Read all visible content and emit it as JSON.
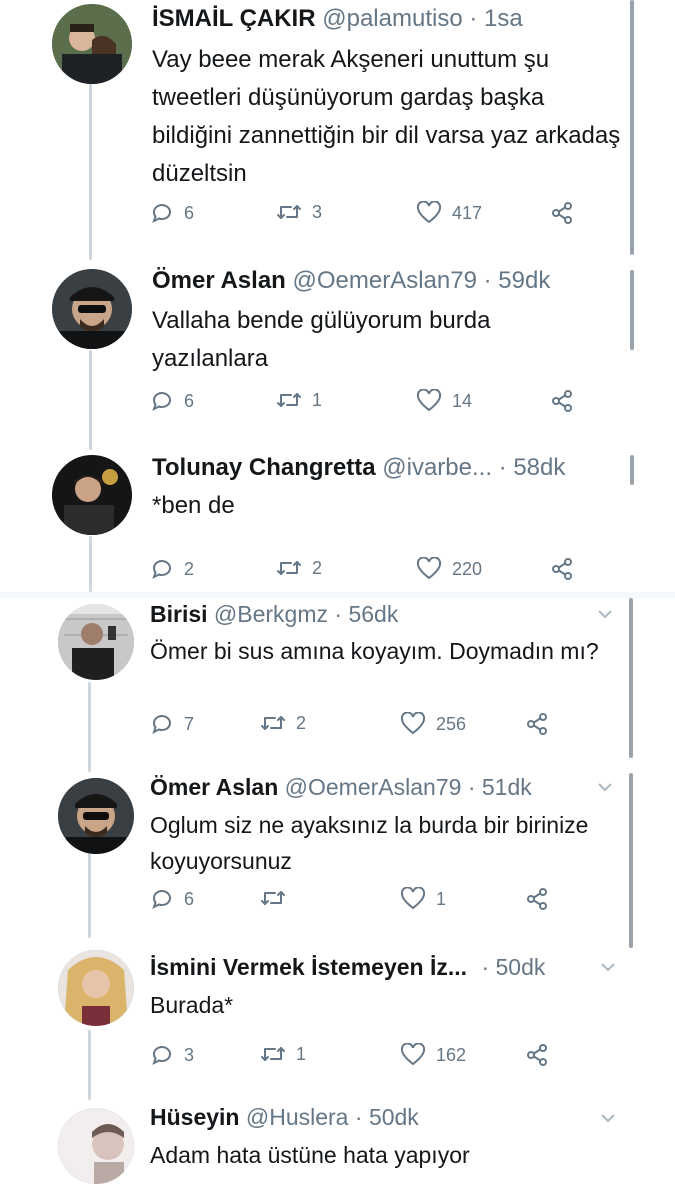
{
  "tweets": [
    {
      "name": "İSMAİL ÇAKIR",
      "handle": "@palamutiso",
      "time": "1sa",
      "text": "Vay beee merak Akşeneri unuttum şu tweetleri düşünüyorum gardaş başka bildiğini zannettiğin bir dil varsa yaz arkadaş düzeltsin",
      "replies": "6",
      "retweets": "3",
      "likes": "417"
    },
    {
      "name": "Ömer Aslan",
      "handle": "@OemerAslan79",
      "time": "59dk",
      "text": "Vallaha bende gülüyorum burda yazılanlara",
      "replies": "6",
      "retweets": "1",
      "likes": "14"
    },
    {
      "name": "Tolunay Changretta",
      "handle": "@ivarbe...",
      "time": "58dk",
      "text": "*ben de",
      "replies": "2",
      "retweets": "2",
      "likes": "220"
    },
    {
      "name": "Birisi",
      "handle": "@Berkgmz",
      "time": "56dk",
      "text": "Ömer bi sus amına koyayım. Doymadın mı?",
      "replies": "7",
      "retweets": "2",
      "likes": "256"
    },
    {
      "name": "Ömer Aslan",
      "handle": "@OemerAslan79",
      "time": "51dk",
      "text": "Oglum siz ne ayaksınız la burda bir birinize koyuyorsunuz",
      "replies": "6",
      "retweets": "",
      "likes": "1"
    },
    {
      "name": "İsmini Vermek İstemeyen İz...",
      "handle": "",
      "time": "50dk",
      "text": "Burada*",
      "replies": "3",
      "retweets": "1",
      "likes": "162"
    },
    {
      "name": "Hüseyin",
      "handle": "@Huslera",
      "time": "50dk",
      "text": "Adam hata üstüne hata yapıyor",
      "replies": "",
      "retweets": "",
      "likes": ""
    }
  ],
  "separator": "·",
  "colors": {
    "name": "#14171a",
    "meta": "#657786",
    "thread": "#ccd6dd"
  }
}
